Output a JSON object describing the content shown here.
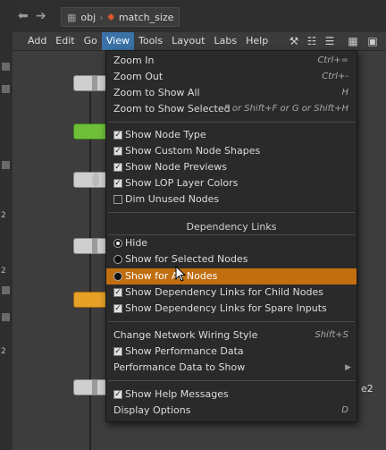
{
  "pathbar": {
    "root": "obj",
    "current": "match_size"
  },
  "menubar": {
    "items": [
      "Add",
      "Edit",
      "Go",
      "View",
      "Tools",
      "Layout",
      "Labs",
      "Help"
    ],
    "active": "View"
  },
  "canvas": {
    "node_label_partial": "e2",
    "left_strip_labels": [
      "2",
      "2",
      "2"
    ]
  },
  "view_menu": {
    "zoom_in": {
      "label": "Zoom In",
      "shortcut": "Ctrl+="
    },
    "zoom_out": {
      "label": "Zoom Out",
      "shortcut": "Ctrl+-"
    },
    "zoom_show_all": {
      "label": "Zoom to Show All",
      "shortcut": "H"
    },
    "zoom_show_selected": {
      "label": "Zoom to Show Selected",
      "shortcut": "F or Shift+F or G or Shift+H"
    },
    "show_node_type": {
      "label": "Show Node Type",
      "checked": true
    },
    "show_custom_shapes": {
      "label": "Show Custom Node Shapes",
      "checked": true
    },
    "show_node_previews": {
      "label": "Show Node Previews",
      "checked": true
    },
    "show_lop_colors": {
      "label": "Show LOP Layer Colors",
      "checked": true
    },
    "dim_unused": {
      "label": "Dim Unused Nodes",
      "checked": false
    },
    "dependency_header": "Dependency Links",
    "dep_hide": {
      "label": "Hide",
      "selected": true
    },
    "dep_selected": {
      "label": "Show for Selected Nodes",
      "selected": false
    },
    "dep_all": {
      "label": "Show for All Nodes",
      "selected": false,
      "highlighted": true
    },
    "dep_child": {
      "label": "Show Dependency Links for Child Nodes",
      "checked": true
    },
    "dep_spare": {
      "label": "Show Dependency Links for Spare Inputs",
      "checked": true
    },
    "wiring_style": {
      "label": "Change Network Wiring Style",
      "shortcut": "Shift+S"
    },
    "show_perf": {
      "label": "Show Performance Data",
      "checked": true
    },
    "perf_to_show": {
      "label": "Performance Data to Show"
    },
    "show_help": {
      "label": "Show Help Messages",
      "checked": true
    },
    "display_options": {
      "label": "Display Options",
      "shortcut": "D"
    }
  },
  "colors": {
    "highlight": "#c06e10",
    "menu_bg": "#2a2a2a",
    "active_menu": "#3b73a8",
    "node_green": "#6fbf3a",
    "node_orange": "#e7a127"
  }
}
